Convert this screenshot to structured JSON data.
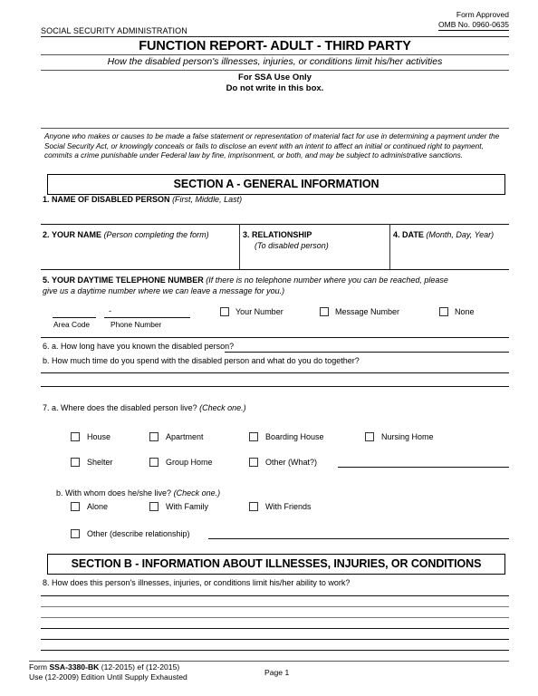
{
  "header": {
    "form_approved": "Form Approved",
    "omb_number": "OMB No. 0960-0635",
    "agency": "SOCIAL SECURITY ADMINISTRATION",
    "title": "FUNCTION REPORT- ADULT - THIRD PARTY",
    "subtitle": "How the disabled person's illnesses, injuries, or conditions limit his/her activities",
    "ssa_use_line1": "For SSA Use Only",
    "ssa_use_line2": "Do not write in this box."
  },
  "warning": {
    "text": "Anyone who makes or causes to be made a false statement or representation of  material fact for use in determining a payment under the Social Security Act, or knowingly conceals or fails to disclose an event with an intent to affect an initial or continued right to payment, commits a crime punishable under Federal law by fine, imprisonment, or both, and may be subject to administrative sanctions."
  },
  "section_a": {
    "bar_label": "SECTION A - GENERAL INFORMATION",
    "q1": {
      "number": "1.",
      "label": "NAME OF DISABLED PERSON",
      "hint": "(First, Middle, Last)"
    },
    "q2": {
      "number": "2.",
      "label": "YOUR NAME",
      "hint": "(Person completing the form)"
    },
    "q3": {
      "number": "3.",
      "label": "RELATIONSHIP",
      "hint": "(To disabled person)"
    },
    "q4": {
      "number": "4.",
      "label": "DATE",
      "hint": "(Month, Day, Year)"
    },
    "q5": {
      "number": "5.",
      "label": "YOUR DAYTIME TELEPHONE NUMBER",
      "hint_line1": "(If there is no telephone number where you can be reached, please",
      "hint_line2": "give us a daytime number where we can leave a message for you.)",
      "area_code_caption": "Area Code",
      "phone_number_caption": "Phone Number",
      "dash": "-",
      "options": [
        {
          "label": "Your Number",
          "checked": false
        },
        {
          "label": "Message Number",
          "checked": false
        },
        {
          "label": "None",
          "checked": false
        }
      ]
    },
    "q6": {
      "a": "6. a. How long have you known the disabled person?",
      "b": "b. How much time do you spend with the disabled person and what do you do together?"
    },
    "q7": {
      "a_text": "7. a. Where does the disabled person live?",
      "a_hint": "(Check one.)",
      "a_options_row1": [
        {
          "label": "House",
          "checked": false
        },
        {
          "label": "Apartment",
          "checked": false
        },
        {
          "label": "Boarding House",
          "checked": false
        },
        {
          "label": "Nursing Home",
          "checked": false
        }
      ],
      "a_options_row2": [
        {
          "label": "Shelter",
          "checked": false
        },
        {
          "label": "Group Home",
          "checked": false
        },
        {
          "label": "Other (What?)",
          "checked": false
        }
      ],
      "b_text": "b. With whom does he/she live?",
      "b_hint": "(Check one.)",
      "b_options": [
        {
          "label": "Alone",
          "checked": false
        },
        {
          "label": "With Family",
          "checked": false
        },
        {
          "label": "With Friends",
          "checked": false
        }
      ],
      "b_other": {
        "label": "Other (describe relationship)",
        "checked": false
      }
    }
  },
  "section_b": {
    "bar_label": "SECTION B - INFORMATION ABOUT ILLNESSES, INJURIES, OR CONDITIONS",
    "q8": "8. How does this person's illnesses, injuries, or conditions limit his/her ability to work?"
  },
  "footer": {
    "form_prefix": "Form ",
    "form_id": "SSA-3380-BK",
    "form_suffix": " (12-2015) ef (12-2015)",
    "edition_note": "Use (12-2009) Edition Until Supply Exhausted",
    "page": "Page 1"
  }
}
